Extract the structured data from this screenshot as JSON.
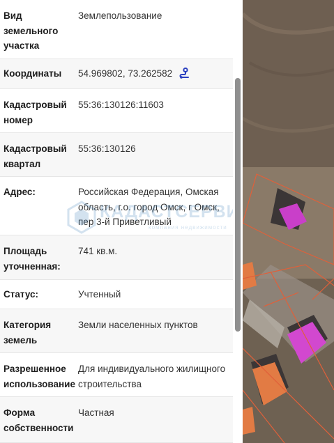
{
  "rows": [
    {
      "label": "Вид земельного участка",
      "value": "Землепользование"
    },
    {
      "label": "Координаты",
      "value": "54.969802, 73.262582"
    },
    {
      "label": "Кадастровый номер",
      "value": "55:36:130126:11603"
    },
    {
      "label": "Кадастровый квартал",
      "value": "55:36:130126"
    },
    {
      "label": "Адрес:",
      "value": "Российская Федерация, Омская область, г.о. город Омск, г Омск, пер 3-й Приветливый"
    },
    {
      "label": "Площадь уточненная:",
      "value": "741 кв.м."
    },
    {
      "label": "Статус:",
      "value": "Учтенный"
    },
    {
      "label": "Категория земель",
      "value": "Земли населенных пунктов"
    },
    {
      "label": "Разрешенное использование",
      "value": "Для индивидуального жилищного строительства"
    },
    {
      "label": "Форма собственности",
      "value": "Частная"
    }
  ],
  "watermark": {
    "name": "КАДАСТСЕРВИС",
    "tagline": "компания недвижимости"
  },
  "icons": {
    "coordinates": "map-route-icon"
  },
  "colors": {
    "accent": "#2a3fbf",
    "parcel_outline": "#e0603a",
    "building_highlight": "#c93fc9"
  }
}
